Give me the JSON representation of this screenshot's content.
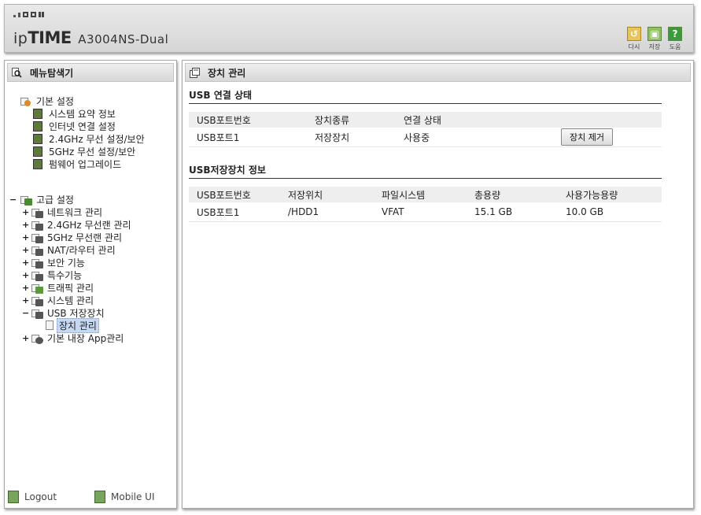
{
  "header": {
    "logo_ip": "ip",
    "logo_time": "TIME",
    "model": "A3004NS-Dual",
    "buttons": [
      {
        "label": "다시",
        "icon": "redo-icon"
      },
      {
        "label": "저장",
        "icon": "save-icon"
      },
      {
        "label": "도움",
        "icon": "help-icon"
      }
    ]
  },
  "sidebar": {
    "title": "메뉴탐색기",
    "basic": {
      "label": "기본 설정",
      "items": [
        "시스템 요약 정보",
        "인터넷 연결 설정",
        "2.4GHz 무선 설정/보안",
        "5GHz 무선 설정/보안",
        "펌웨어 업그레이드"
      ]
    },
    "advanced": {
      "label": "고급 설정",
      "items": [
        "네트워크 관리",
        "2.4GHz 무선랜 관리",
        "5GHz 무선랜 관리",
        "NAT/라우터 관리",
        "보안 기능",
        "특수기능",
        "트래픽 관리",
        "시스템 관리",
        "USB 저장장치"
      ],
      "usb_child": "장치 관리",
      "last": "기본 내장 App관리"
    },
    "footer": {
      "logout": "Logout",
      "mobile": "Mobile UI"
    }
  },
  "main": {
    "title": "장치 관리",
    "usb_conn": {
      "title": "USB 연결 상태",
      "headers": [
        "USB포트번호",
        "장치종류",
        "연결 상태",
        ""
      ],
      "row": {
        "port": "USB포트1",
        "type": "저장장치",
        "status": "사용중",
        "button": "장치 제거"
      }
    },
    "usb_info": {
      "title": "USB저장장치 정보",
      "headers": [
        "USB포트번호",
        "저장위치",
        "파일시스템",
        "총용량",
        "사용가능용량"
      ],
      "row": [
        "USB포트1",
        "/HDD1",
        "VFAT",
        "15.1 GB",
        "10.0 GB"
      ]
    }
  }
}
